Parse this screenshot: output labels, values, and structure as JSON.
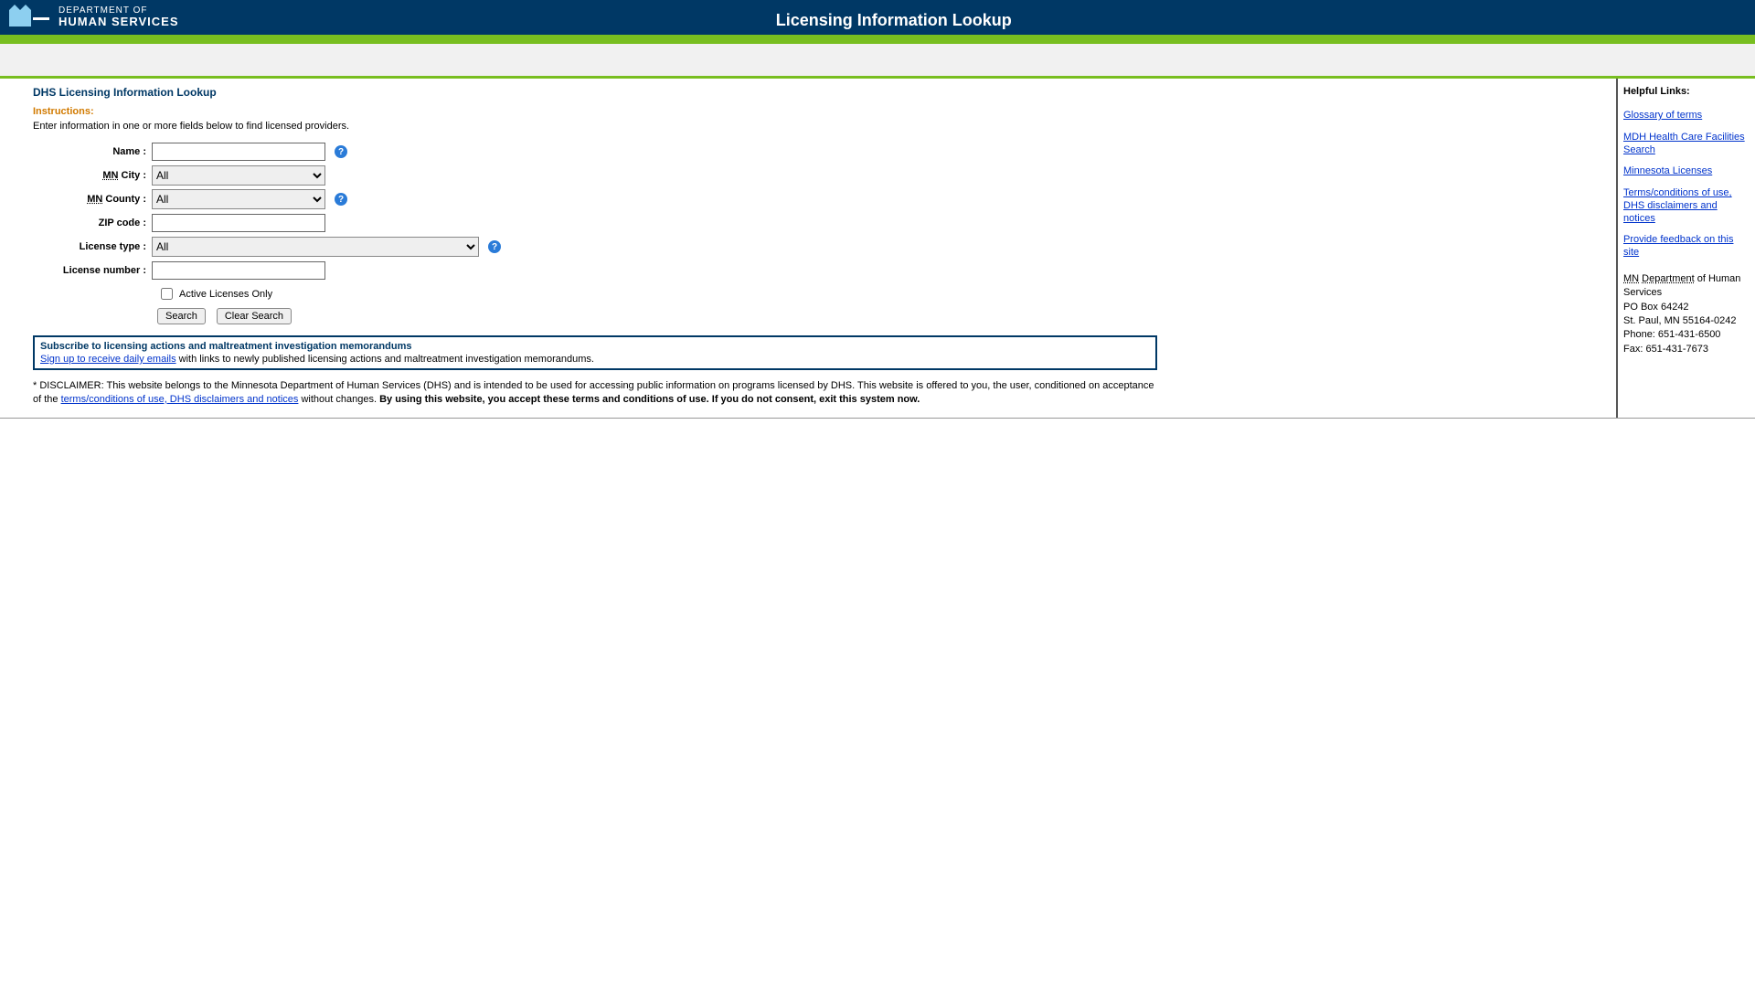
{
  "header": {
    "app_title": "Licensing Information Lookup",
    "dept_line1": "DEPARTMENT OF",
    "dept_line2": "HUMAN SERVICES"
  },
  "main": {
    "page_heading": "DHS Licensing Information Lookup",
    "instructions_heading": "Instructions:",
    "instructions_text": "Enter information in one or more fields below to find licensed providers.",
    "form": {
      "name": {
        "label": "Name :",
        "value": ""
      },
      "city": {
        "label_prefix": "MN",
        "label_suffix": " City :",
        "selected": "All"
      },
      "county": {
        "label_prefix": "MN",
        "label_suffix": " County :",
        "selected": "All"
      },
      "zip": {
        "label": "ZIP code :",
        "value": ""
      },
      "license_type": {
        "label": "License type :",
        "selected": "All"
      },
      "license_number": {
        "label": "License number :",
        "value": ""
      },
      "active_only": {
        "label": "Active Licenses Only",
        "checked": false
      },
      "buttons": {
        "search": "Search",
        "clear": "Clear Search"
      },
      "help_glyph": "?"
    },
    "subscribe": {
      "title": "Subscribe to licensing actions and maltreatment investigation memorandums",
      "link_text": "Sign up to receive daily emails",
      "after_link": " with links to newly published licensing actions and maltreatment investigation memorandums."
    },
    "disclaimer": {
      "prefix": "* DISCLAIMER: This website belongs to the Minnesota Department of Human Services (DHS) and is intended to be used for accessing public information on programs licensed by DHS. This website is offered to you, the user, conditioned on acceptance of the ",
      "link_text": "terms/conditions of use, DHS disclaimers and notices",
      "middle": " without changes. ",
      "bold": "By using this website, you accept these terms and conditions of use. If you do not consent, exit this system now."
    }
  },
  "sidebar": {
    "heading": "Helpful Links:",
    "links": {
      "glossary": "Glossary of terms",
      "mdh": "MDH Health Care Facilities Search",
      "mn_licenses": "Minnesota Licenses",
      "terms": "Terms/conditions of use, DHS disclaimers and notices",
      "feedback": "Provide feedback on this site"
    },
    "address": {
      "state_abbr": "MN",
      "dept_abbr": "Department",
      "line1_suffix": " of Human Services",
      "po": "PO Box 64242",
      "citystate": "St. Paul, MN 55164-0242",
      "phone": "Phone: 651-431-6500",
      "fax": "Fax: 651-431-7673"
    }
  }
}
